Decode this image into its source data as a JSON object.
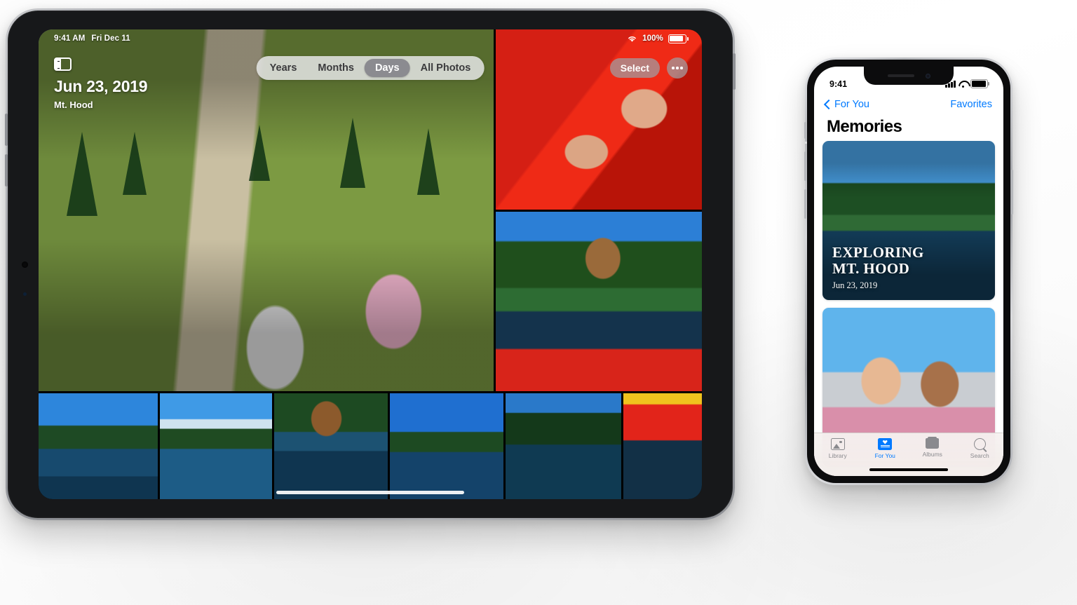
{
  "scene": {
    "background_color": "#ffffff",
    "devices": [
      "iPad Pro",
      "iPhone"
    ]
  },
  "ipad": {
    "status_bar": {
      "time": "9:41 AM",
      "date": "Fri Dec 11",
      "wifi_icon": "wifi-icon",
      "battery_percent": "100%",
      "battery_icon": "battery-icon"
    },
    "header": {
      "sidebar_icon": "sidebar-toggle-icon",
      "day_title": "Jun 23, 2019",
      "day_subtitle": "Mt. Hood"
    },
    "segmented_control": {
      "options": [
        "Years",
        "Months",
        "Days",
        "All Photos"
      ],
      "selected": "Days",
      "selected_bg": "#8b8b90"
    },
    "actions": {
      "select_label": "Select",
      "more_icon": "ellipsis-icon"
    },
    "photos": {
      "hero": {
        "name": "hikers-on-mountain-trail",
        "alt": "Kids hiking a trail with a pink balloon"
      },
      "right_column": [
        {
          "name": "hands-on-red-canoe",
          "alt": "Hands resting on red canoe gunwale"
        },
        {
          "name": "woman-red-hoodie-canoe",
          "alt": "Woman in red hoodie leaning over canoe"
        }
      ],
      "bottom_row": [
        {
          "name": "canoe-on-lake-wide",
          "alt": "Red canoe on lake with forest"
        },
        {
          "name": "paddler-with-mt-hood",
          "alt": "Paddler in canoe with Mt. Hood behind"
        },
        {
          "name": "portrait-red-hoodie",
          "alt": "Portrait of woman in red hoodie on water"
        },
        {
          "name": "canoe-distant-lake",
          "alt": "Distant red canoe on calm blue lake"
        },
        {
          "name": "canoe-forest-reflection",
          "alt": "Canoe by forest shoreline reflection"
        },
        {
          "name": "red-canoe-reflection",
          "alt": "Close-up red and yellow canoe reflection"
        }
      ]
    },
    "home_indicator": "home-indicator"
  },
  "iphone": {
    "status_bar": {
      "time": "9:41",
      "cellular_icon": "cellular-bars-icon",
      "wifi_icon": "wifi-icon",
      "battery_icon": "battery-icon"
    },
    "nav_bar": {
      "back_label": "For You",
      "back_icon": "chevron-left-icon",
      "right_action": "Favorites",
      "accent_color": "#007aff"
    },
    "page_title": "Memories",
    "memories": [
      {
        "photo": "canoe-lake-mt-hood",
        "title_line1": "EXPLORING",
        "title_line2": "MT. HOOD",
        "date": "Jun 23, 2019"
      },
      {
        "photo": "two-friends-selfie",
        "title_line1": "",
        "title_line2": "",
        "date": ""
      }
    ],
    "tab_bar": {
      "tabs": [
        {
          "label": "Library",
          "icon": "photos-library-icon",
          "active": false
        },
        {
          "label": "For You",
          "icon": "for-you-icon",
          "active": true
        },
        {
          "label": "Albums",
          "icon": "albums-icon",
          "active": false
        },
        {
          "label": "Search",
          "icon": "search-icon",
          "active": false
        }
      ],
      "active_color": "#007aff",
      "inactive_color": "#8a8a8e"
    },
    "home_indicator": "home-indicator"
  }
}
